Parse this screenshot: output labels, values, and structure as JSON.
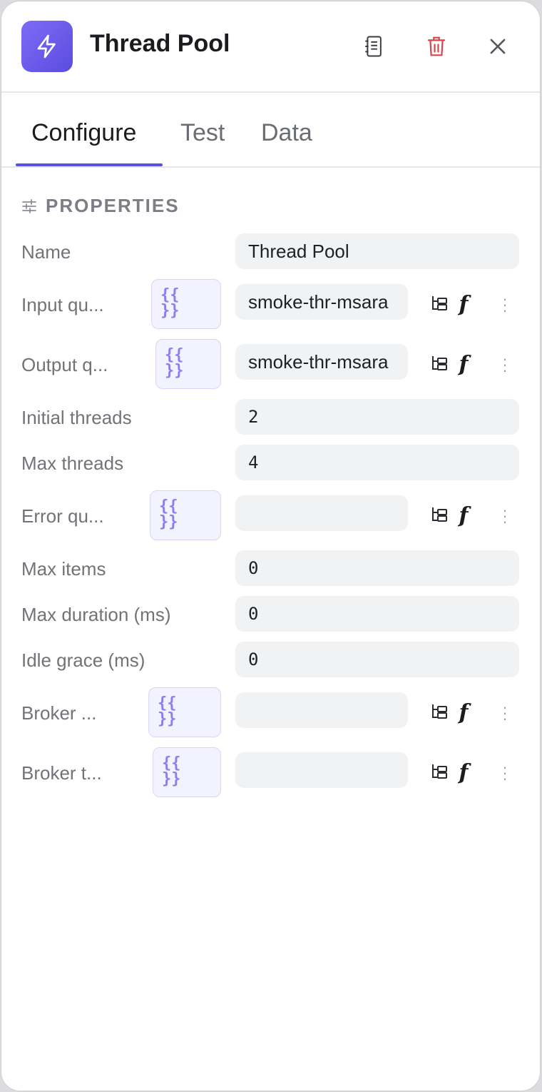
{
  "header": {
    "title": "Thread Pool",
    "app_icon": "lightning-icon",
    "accent": "#6355e6"
  },
  "tabs": [
    {
      "label": "Configure"
    },
    {
      "label": "Test"
    },
    {
      "label": "Data"
    }
  ],
  "section": {
    "label": "PROPERTIES"
  },
  "props": {
    "name": {
      "label": "Name",
      "value": "Thread Pool"
    },
    "input_queue": {
      "label": "Input qu...",
      "expr": "{{\n}}",
      "value": "smoke-thr-msara"
    },
    "output_queue": {
      "label": "Output q...",
      "expr": "{{\n}}",
      "value": "smoke-thr-msara"
    },
    "initial_threads": {
      "label": "Initial threads",
      "value": "2"
    },
    "max_threads": {
      "label": "Max threads",
      "value": "4"
    },
    "error_queue": {
      "label": "Error qu...",
      "expr": "{{\n}}",
      "value": ""
    },
    "max_items": {
      "label": "Max items",
      "value": "0"
    },
    "max_duration": {
      "label": "Max duration (ms)",
      "value": "0"
    },
    "idle_grace": {
      "label": "Idle grace (ms)",
      "value": "0"
    },
    "broker_1": {
      "label": "Broker ...",
      "expr": "{{\n}}",
      "value": ""
    },
    "broker_2": {
      "label": "Broker t...",
      "expr": "{{\n}}",
      "value": ""
    }
  },
  "icons": {
    "fx_label": "f",
    "menu": "⋮"
  }
}
